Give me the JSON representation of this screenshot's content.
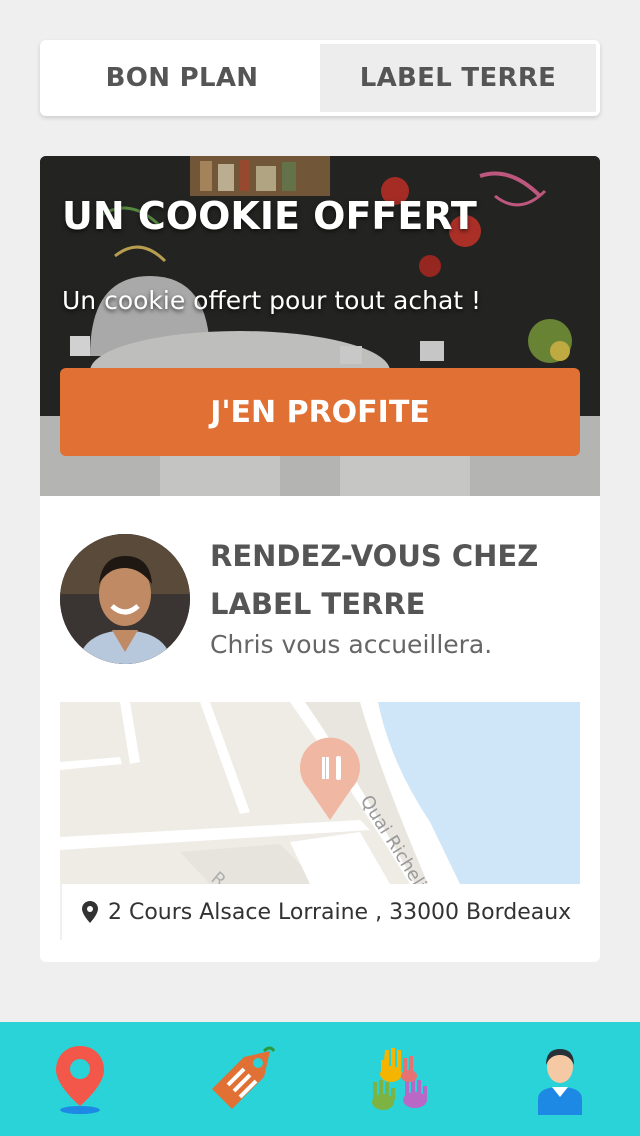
{
  "tabs": {
    "bon_plan": "BON PLAN",
    "label_terre": "LABEL TERRE"
  },
  "offer": {
    "title": "UN COOKIE OFFERT",
    "subtitle": "Un cookie offert pour tout achat !",
    "cta_label": "J'EN PROFITE"
  },
  "host": {
    "title": "RENDEZ-VOUS CHEZ LABEL TERRE",
    "subtitle": "Chris vous accueillera."
  },
  "map": {
    "street_label": "Quai Richelieu",
    "street_label_2": "R"
  },
  "address": {
    "text": "2 Cours Alsace Lorraine , 33000 Bordeaux"
  },
  "bottom_nav": {
    "items": [
      "map-pin-icon",
      "price-tag-icon",
      "hands-icon",
      "user-profile-icon"
    ]
  },
  "colors": {
    "accent_orange": "#e07033",
    "nav_bg": "#2ad3d8",
    "pin_red": "#f2574a",
    "tag_orange": "#e07033",
    "user_blue": "#1e88e5"
  }
}
